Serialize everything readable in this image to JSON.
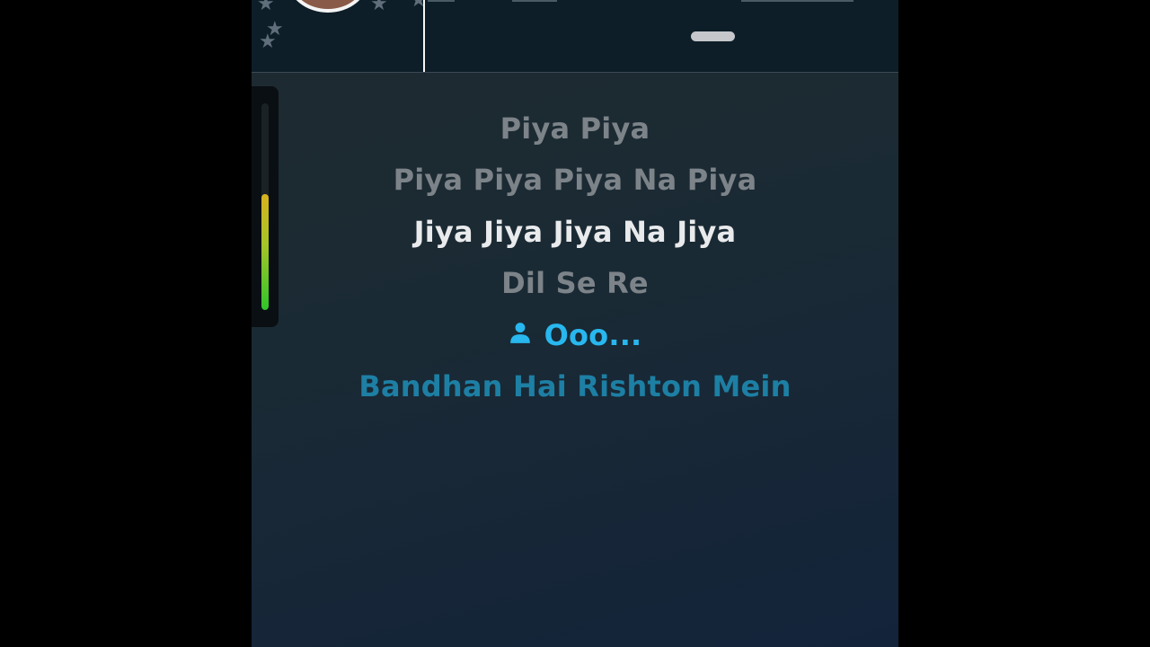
{
  "header": {
    "star_icons": [
      "star-icon",
      "star-icon",
      "star-icon",
      "star-icon",
      "star-icon"
    ]
  },
  "meter": {
    "level": 0.56,
    "colors": [
      "#d8b21e",
      "#a3c428",
      "#2fc52a"
    ]
  },
  "lyrics": {
    "lines": [
      {
        "text": "Piya Piya",
        "state": "past"
      },
      {
        "text": "Piya Piya Piya Na Piya",
        "state": "past"
      },
      {
        "text": "Jiya Jiya Jiya Na Jiya",
        "state": "current"
      },
      {
        "text": "Dil Se Re",
        "state": "past"
      },
      {
        "text": "Ooo...",
        "state": "next",
        "icon": "person-icon"
      },
      {
        "text": "Bandhan Hai Rishton Mein",
        "state": "upcoming"
      }
    ]
  },
  "colors": {
    "accent": "#28b7ee",
    "current_line": "#e9eaec",
    "past_line": "#7c8389"
  }
}
